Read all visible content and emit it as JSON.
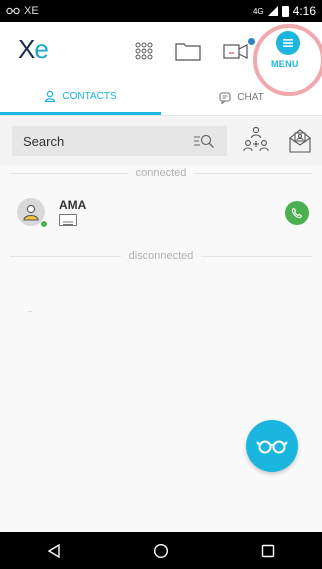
{
  "status_bar": {
    "left_icon": "glasses-icon",
    "left_text": "XE",
    "signal": "4G",
    "time": "4:16"
  },
  "app": {
    "logo_x": "X",
    "logo_e": "e"
  },
  "header": {
    "menu_label": "MENU"
  },
  "tabs": [
    {
      "label": "CONTACTS",
      "icon": "person-icon",
      "active": true
    },
    {
      "label": "CHAT",
      "icon": "chat-icon",
      "active": false
    }
  ],
  "search": {
    "placeholder": "Search"
  },
  "sections": {
    "connected": "connected",
    "disconnected": "disconnected"
  },
  "contacts": [
    {
      "name": "AMA",
      "status": "online"
    }
  ],
  "empty_text": "–",
  "colors": {
    "accent": "#1bb6e0",
    "online": "#4caf50",
    "highlight_ring": "#f1a9ad"
  }
}
